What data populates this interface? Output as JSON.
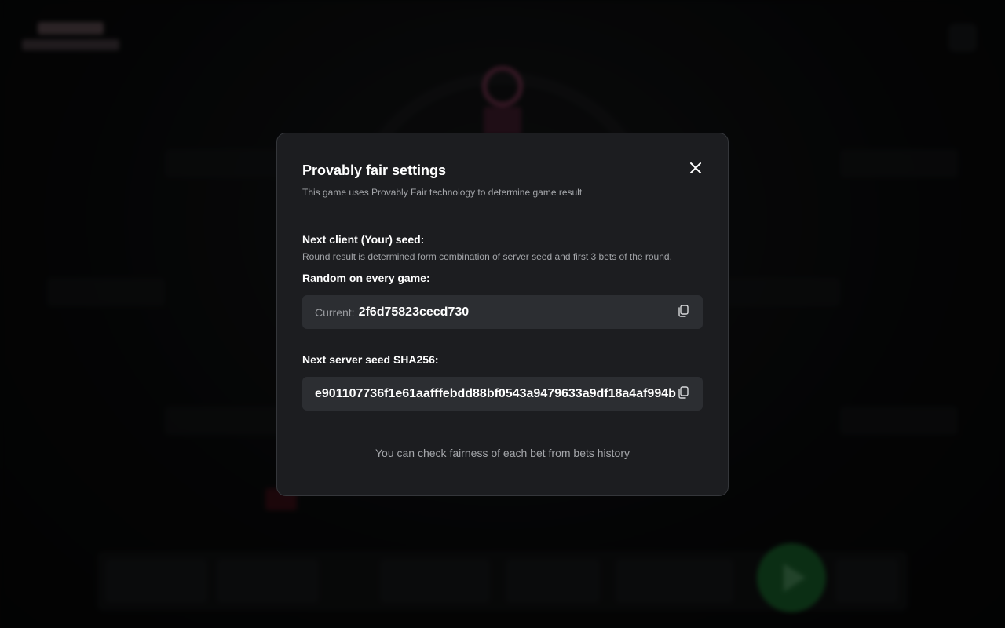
{
  "modal": {
    "title": "Provably fair settings",
    "subtitle": "This game uses Provably Fair technology to determine game result",
    "close_icon": "close-icon",
    "client_seed": {
      "label": "Next client (Your) seed:",
      "description": "Round result is determined form combination of server seed and first 3 bets of the round.",
      "mode_label": "Random on every game:",
      "prefix": "Current:",
      "value": "2f6d75823cecd730",
      "copy_icon": "copy-icon"
    },
    "server_seed": {
      "label": "Next server seed SHA256:",
      "value": "e901107736f1e61aafffebdd88bf0543a9479633a9df18a4af994b",
      "copy_icon": "copy-icon"
    },
    "footer_note": "You can check fairness of each bet from bets history"
  },
  "colors": {
    "modal_background": "#1c1d20",
    "field_background": "#2c2e32",
    "muted_text": "#a4a6aa"
  }
}
